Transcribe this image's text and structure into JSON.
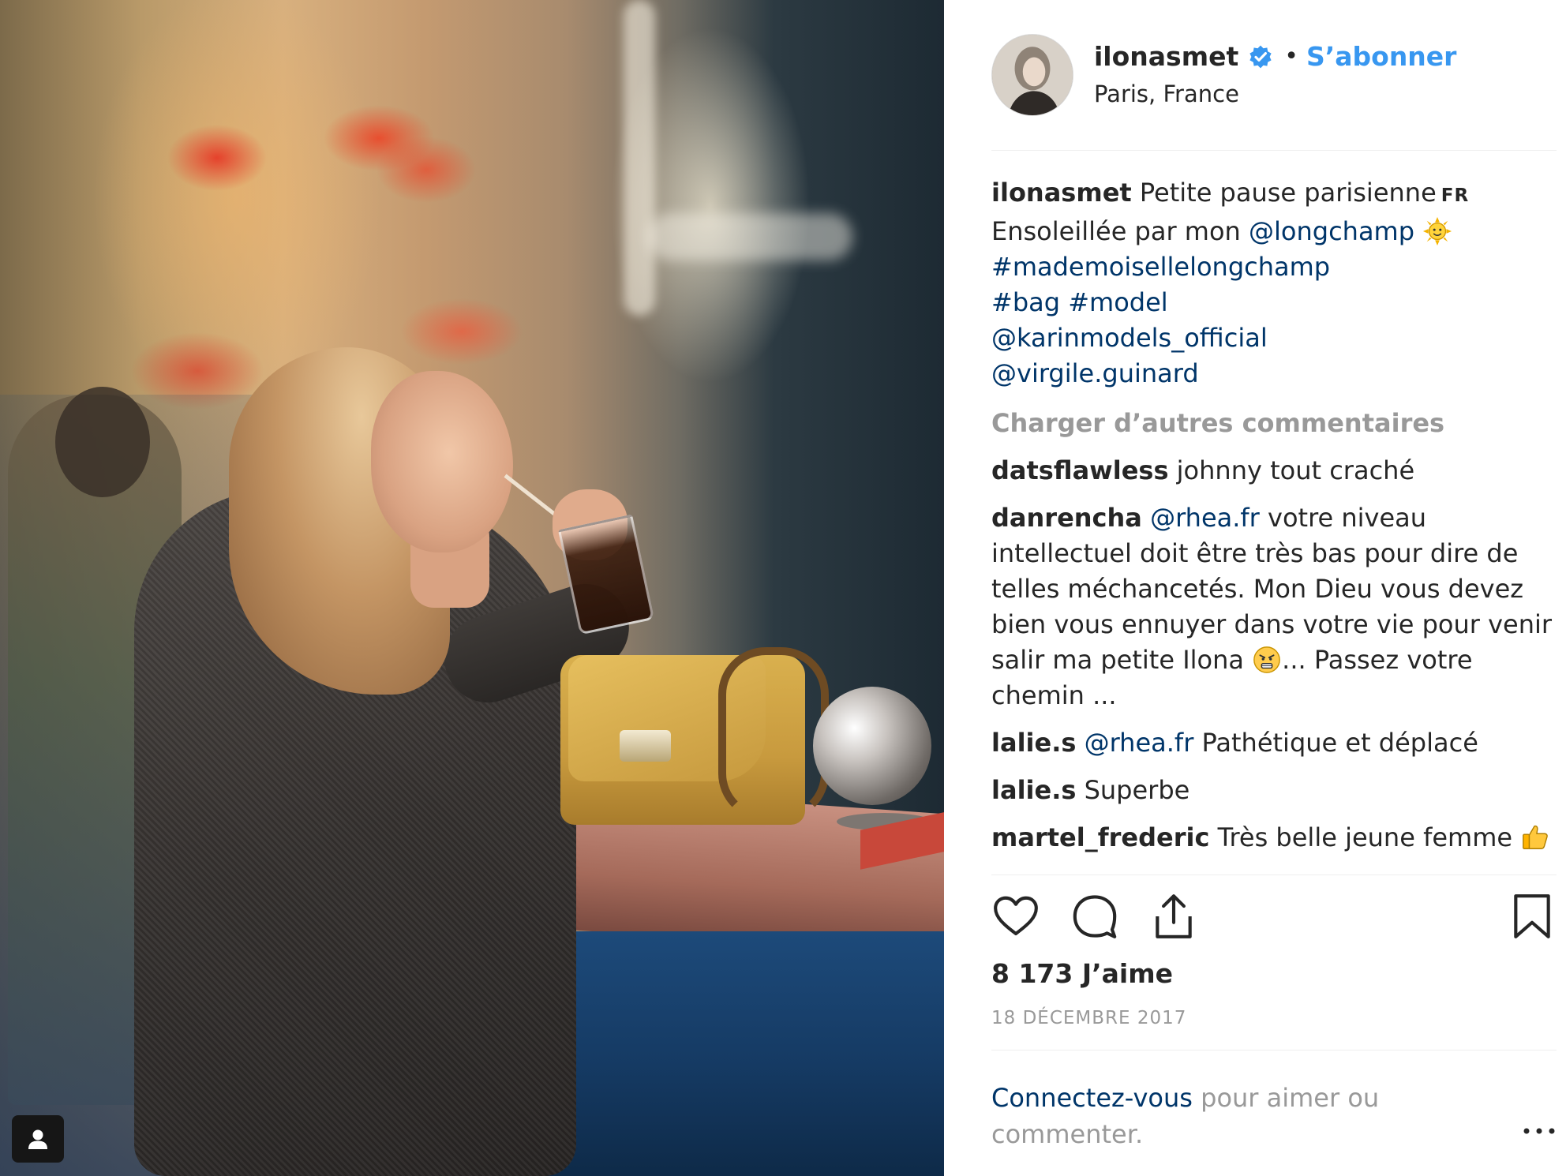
{
  "post": {
    "username": "ilonasmet",
    "follow_label": "S’abonner",
    "separator": "•",
    "location": "Paris, France"
  },
  "caption": {
    "username": "ilonasmet",
    "text_line1": "Petite pause parisienne",
    "translate_label": "FR",
    "text_line2": "Ensoleillée par mon",
    "mention_longchamp": "@longchamp",
    "hashtag_mademoiselle": "#mademoisellelongchamp",
    "hashtag_bag": "#bag",
    "hashtag_model": "#model",
    "mention_karin": "@karinmodels_official",
    "mention_virgile": "@virgile.guinard"
  },
  "load_more_label": "Charger d’autres commentaires",
  "comments": [
    {
      "user": "datsflawless",
      "text": "johnny tout craché"
    },
    {
      "user": "danrencha",
      "mention": "@rhea.fr",
      "text": "votre niveau intellectuel doit être très bas pour dire de telles méchancetés. Mon Dieu vous devez bien vous ennuyer dans votre vie pour venir salir ma petite Ilona",
      "text_after": "... Passez votre chemin ..."
    },
    {
      "user": "lalie.s",
      "mention": "@rhea.fr",
      "text": "Pathétique et déplacé"
    },
    {
      "user": "lalie.s",
      "text": "Superbe"
    },
    {
      "user": "martel_frederic",
      "text": "Très belle jeune femme"
    }
  ],
  "icons": {
    "like": "heart-icon",
    "comment": "comment-icon",
    "share": "share-icon",
    "save": "bookmark-icon",
    "verified": "verified-badge-icon",
    "user_tag": "user-tag-icon",
    "more": "more-options-icon"
  },
  "colors": {
    "follow": "#3897f0",
    "link": "#003569",
    "muted": "#999999",
    "text": "#262626"
  },
  "likes_label": "8 173 J’aime",
  "date_label": "18 DÉCEMBRE 2017",
  "login": {
    "link_label": "Connectez-vous",
    "rest_label": "pour aimer ou commenter."
  }
}
